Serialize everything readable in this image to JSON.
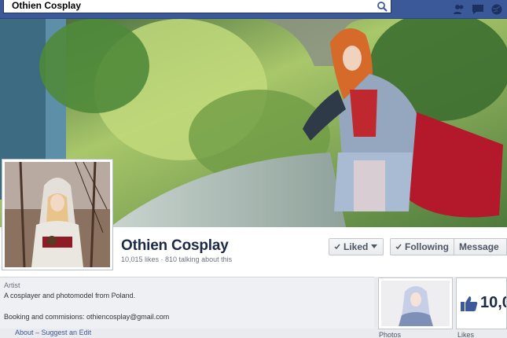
{
  "search": {
    "value": "Othien Cosplay"
  },
  "page": {
    "name": "Othien Cosplay",
    "stats": "10,015 likes · 810 talking about this"
  },
  "actions": {
    "liked": "Liked",
    "following": "Following",
    "message": "Message"
  },
  "about": {
    "category": "Artist",
    "description": "A cosplayer and photomodel from Poland.",
    "booking": "Booking and commisions: othiencosplay@gmail.com",
    "links": "About – Suggest an Edit"
  },
  "tiles": {
    "photos_label": "Photos",
    "likes_count": "10,0",
    "likes_label": "Likes"
  },
  "colors": {
    "brand": "#3b5998",
    "name_text": "#1c2a47"
  }
}
